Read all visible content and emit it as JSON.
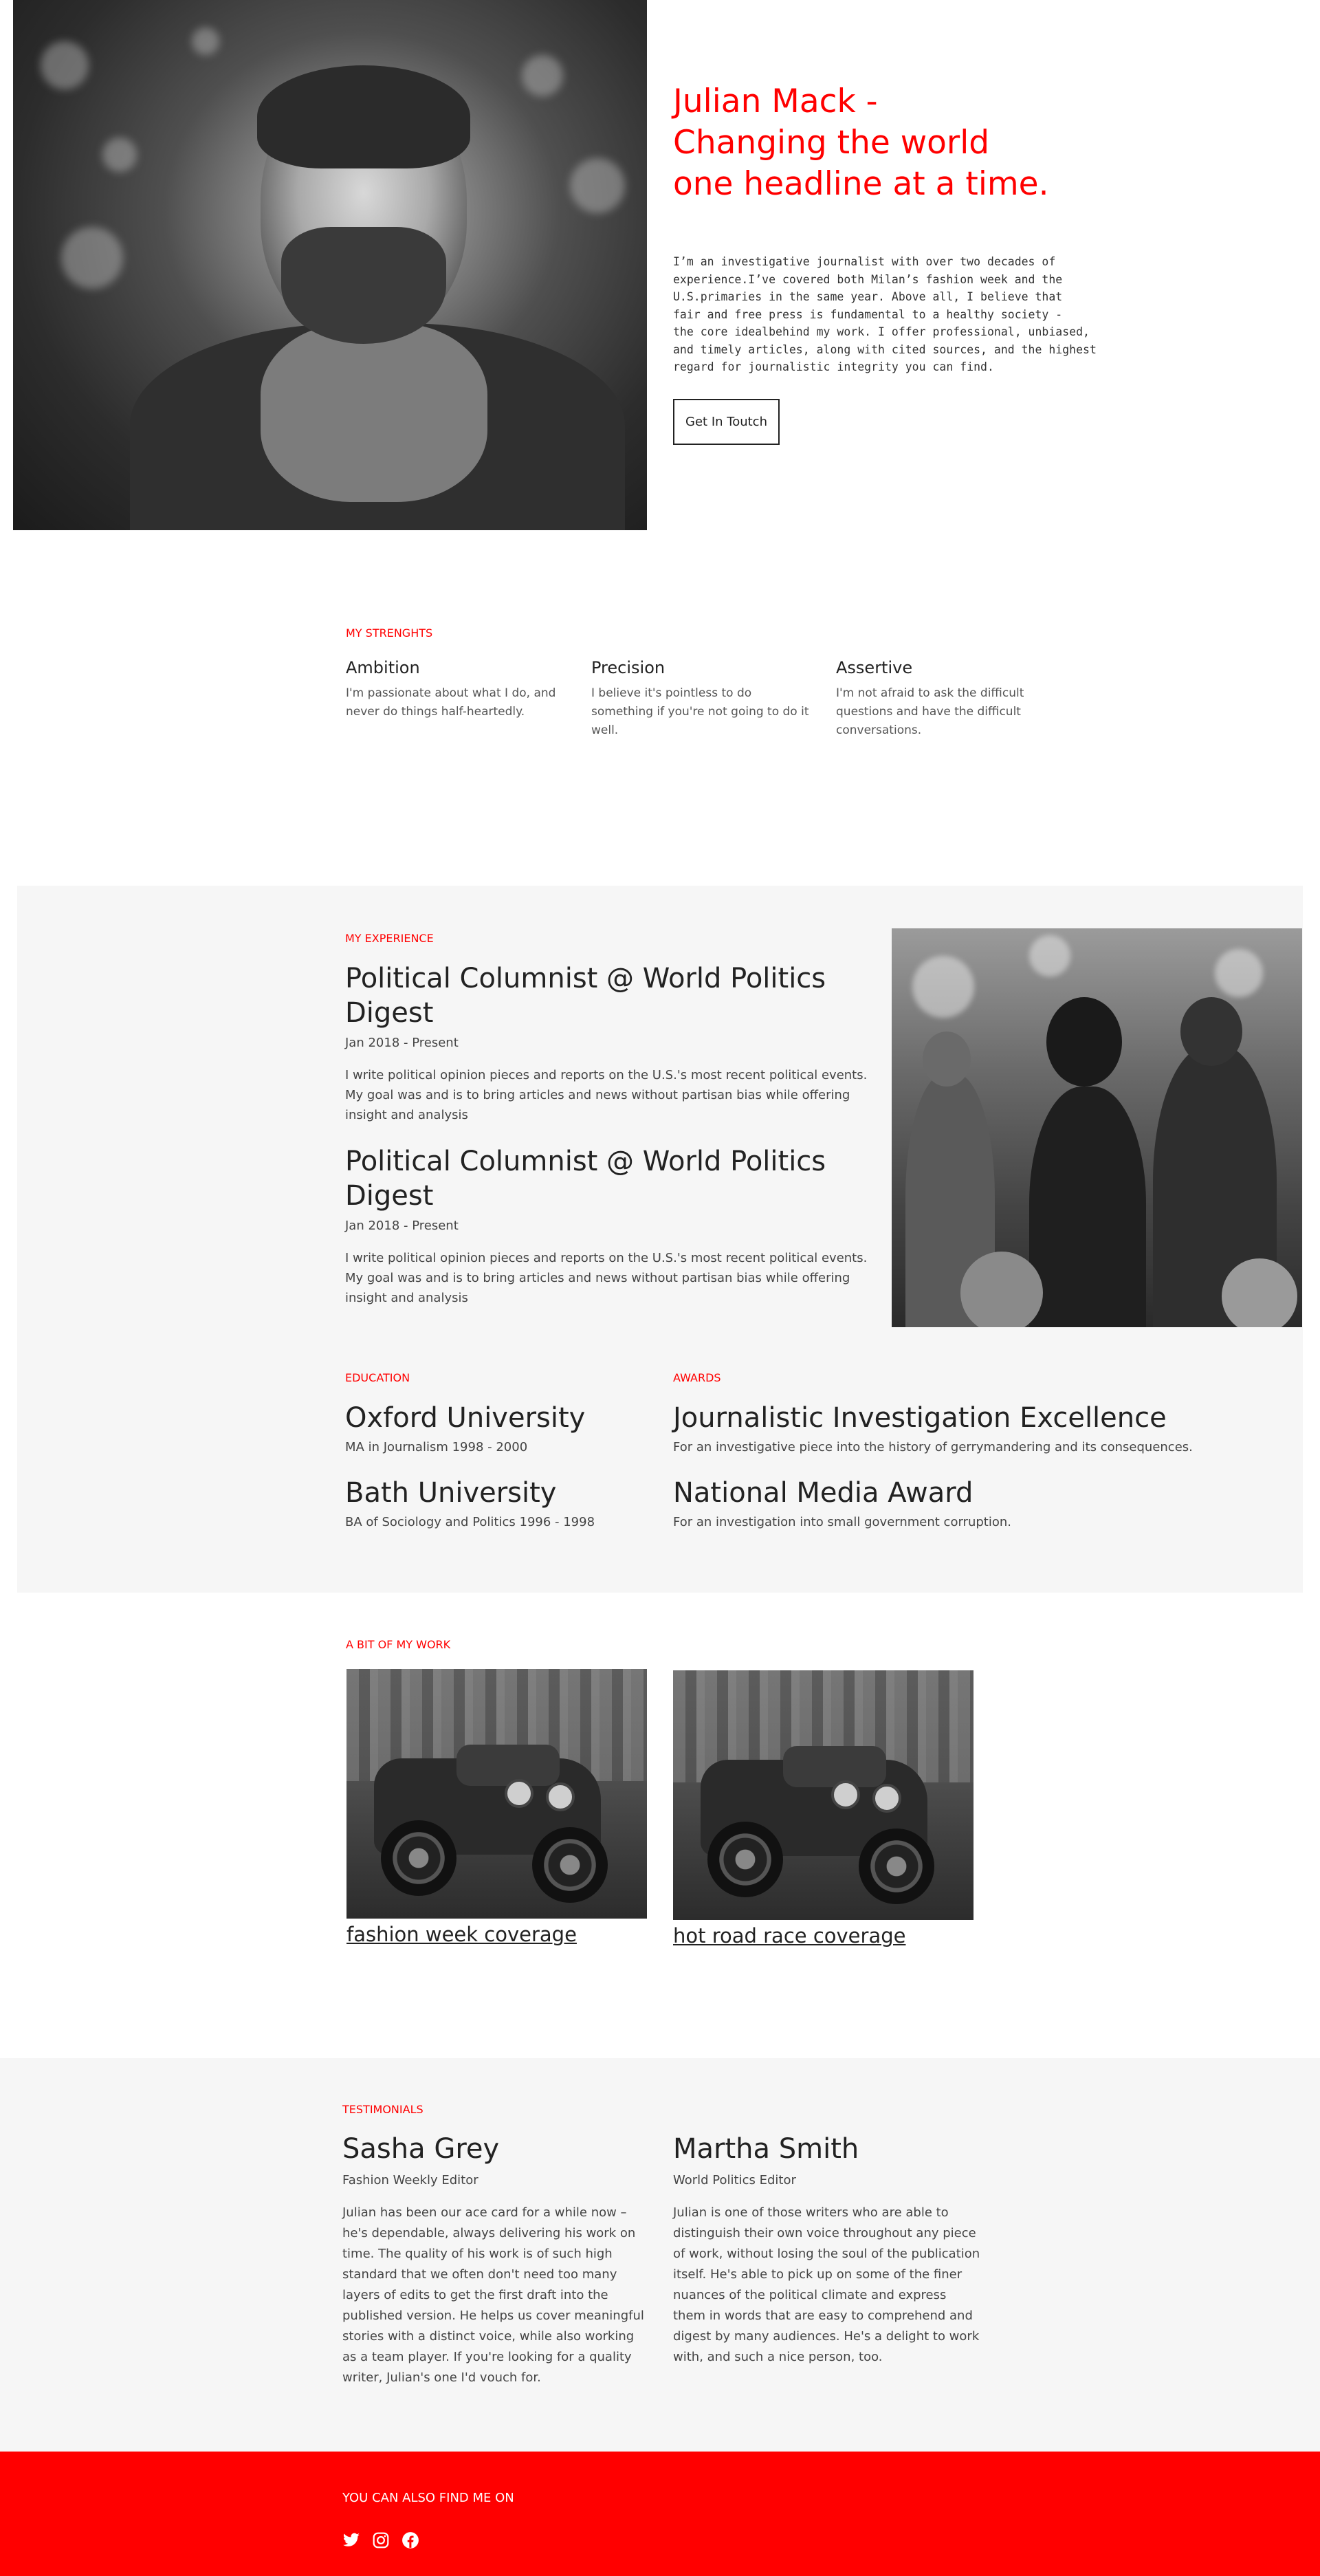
{
  "hero": {
    "title_line1": "Julian Mack -",
    "title_line2": "Changing the world",
    "title_line3": "one headline at a time.",
    "bio_lines": [
      "I’m an investigative journalist with over two decades of",
      "experience.I’ve covered both Milan’s fashion week and the",
      "U.S.primaries in the same year. Above all, I believe that",
      "fair and free press is fundamental to a healthy society -",
      "the core idealbehind my work. I offer professional, unbiased,",
      "and timely articles, along with cited sources, and the highest",
      "regard for journalistic integrity you can find."
    ],
    "button_label": "Get In Toutch"
  },
  "strengths": {
    "label": "MY STRENGHTS",
    "items": [
      {
        "title": "Ambition",
        "desc": "I'm passionate about what I do, and never do things half-heartedly."
      },
      {
        "title": "Precision",
        "desc": "I believe it's pointless to do something if you're not going to do it well."
      },
      {
        "title": "Assertive",
        "desc": "I'm not afraid to ask the difficult questions and have the difficult conversations."
      }
    ]
  },
  "experience": {
    "label": "MY EXPERIENCE",
    "items": [
      {
        "title": "Political Columnist @ World Politics Digest",
        "date": "Jan 2018 - Present",
        "desc": "I write political opinion pieces and reports on the U.S.'s most recent political events. My goal was and is to bring articles and news without partisan bias while offering insight and analysis"
      },
      {
        "title": "Political Columnist @ World Politics Digest",
        "date": "Jan 2018 - Present",
        "desc": "I write political opinion pieces and reports on the U.S.'s most recent political events. My goal was and is to bring articles and news without partisan bias while offering insight and analysis"
      }
    ]
  },
  "education": {
    "label": "EDUCATION",
    "items": [
      {
        "title": "Oxford University",
        "detail": "MA in Journalism 1998 - 2000"
      },
      {
        "title": "Bath University",
        "detail": "BA of Sociology and Politics 1996 - 1998"
      }
    ]
  },
  "awards": {
    "label": "AWARDS",
    "items": [
      {
        "title": "Journalistic Investigation Excellence",
        "detail": "For an investigative piece into the history of gerrymandering and its consequences."
      },
      {
        "title": "National Media Award",
        "detail": "For an investigation into small government corruption."
      }
    ]
  },
  "work": {
    "label": "A BIT OF MY WORK",
    "items": [
      {
        "link": "fashion week coverage"
      },
      {
        "link": "hot road race coverage"
      }
    ]
  },
  "testimonials": {
    "label": "TESTIMONIALS",
    "items": [
      {
        "name": "Sasha Grey",
        "role": "Fashion Weekly Editor",
        "quote": "Julian has been our ace card for a while now – he's dependable, always delivering his work on time. The quality of his work is of such high standard that we often don't need too many layers of edits to get the first draft into the published version. He helps us cover meaningful stories with a distinct voice, while also working as a team player. If you're looking for a quality writer, Julian's one I'd vouch for."
      },
      {
        "name": "Martha Smith",
        "role": "World Politics Editor",
        "quote": "Julian is one of those writers who are able to distinguish their own voice throughout any piece of work, without losing the soul of the publication itself. He's able to pick up on some of the finer nuances of the political climate and express them in words that are easy to comprehend and digest by many audiences. He's a delight to work with, and such a nice person, too."
      }
    ]
  },
  "footer": {
    "label": "YOU CAN ALSO FIND ME ON",
    "icons": [
      "twitter-icon",
      "instagram-icon",
      "facebook-icon"
    ]
  },
  "colors": {
    "accent": "#ff0000",
    "section_grey": "#f6f6f6",
    "text_dark": "#222222"
  }
}
